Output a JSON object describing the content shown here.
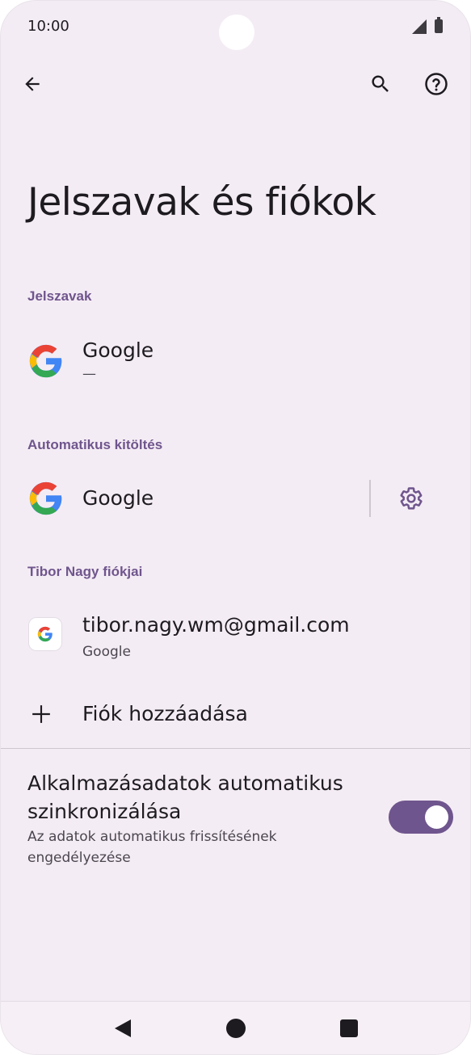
{
  "status_bar": {
    "time": "10:00"
  },
  "header": {
    "back_icon": "arrow-back-icon",
    "search_icon": "search-icon",
    "help_icon": "help-icon"
  },
  "page": {
    "title": "Jelszavak és fiókok"
  },
  "passwords": {
    "section_label": "Jelszavak",
    "item": {
      "title": "Google",
      "subtitle": "—"
    }
  },
  "autofill": {
    "section_label": "Automatikus kitöltés",
    "item": {
      "title": "Google",
      "settings_icon": "gear-icon"
    }
  },
  "accounts": {
    "section_label": "Tibor Nagy fiókjai",
    "items": [
      {
        "title": "tibor.nagy.wm@gmail.com",
        "subtitle": "Google"
      }
    ],
    "add_label": "Fiók hozzáadása"
  },
  "sync": {
    "title": "Alkalmazásadatok automatikus szinkronizálása",
    "subtitle": "Az adatok automatikus frissítésének engedélyezése",
    "enabled": true
  },
  "colors": {
    "accent": "#6f558d",
    "background": "#f4ecf4",
    "text": "#1d1b20"
  },
  "nav": {
    "back_icon": "nav-back-icon",
    "home_icon": "nav-home-icon",
    "recents_icon": "nav-recents-icon"
  }
}
